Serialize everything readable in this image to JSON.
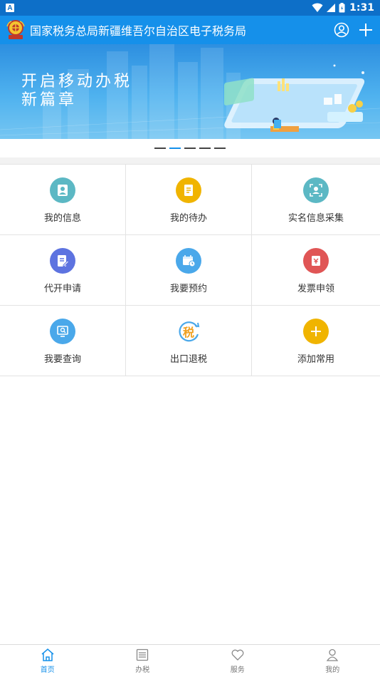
{
  "status_bar": {
    "time": "1:31",
    "app_badge": "A"
  },
  "header": {
    "title": "国家税务总局新疆维吾尔自治区电子税务局",
    "logo_icon": "tax-emblem-icon",
    "user_icon": "user-circle-icon",
    "add_icon": "plus-icon",
    "bg_color": "#1590ea"
  },
  "banner": {
    "line1": "开启移动办税",
    "line2": "新篇章",
    "dots_total": 5,
    "dots_active_index": 1
  },
  "grid": [
    {
      "label": "我的信息",
      "icon": "person-card-icon",
      "color": "#5cb8c4"
    },
    {
      "label": "我的待办",
      "icon": "document-list-icon",
      "color": "#f0b400"
    },
    {
      "label": "实名信息采集",
      "icon": "face-scan-icon",
      "color": "#5cb8c4"
    },
    {
      "label": "代开申请",
      "icon": "edit-document-icon",
      "color": "#5d73e0"
    },
    {
      "label": "我要预约",
      "icon": "calendar-clock-icon",
      "color": "#4aa8ea"
    },
    {
      "label": "发票申领",
      "icon": "invoice-icon",
      "color": "#e05555"
    },
    {
      "label": "我要查询",
      "icon": "search-screen-icon",
      "color": "#4aa8ea"
    },
    {
      "label": "出口退税",
      "icon": "tax-refund-icon",
      "color": "#f0a020",
      "glyph": "税"
    },
    {
      "label": "添加常用",
      "icon": "plus-icon",
      "color": "#f0b400"
    }
  ],
  "bottom_nav": [
    {
      "label": "首页",
      "icon": "home-icon",
      "active": true
    },
    {
      "label": "办税",
      "icon": "list-icon",
      "active": false
    },
    {
      "label": "服务",
      "icon": "heart-icon",
      "active": false
    },
    {
      "label": "我的",
      "icon": "person-icon",
      "active": false
    }
  ]
}
